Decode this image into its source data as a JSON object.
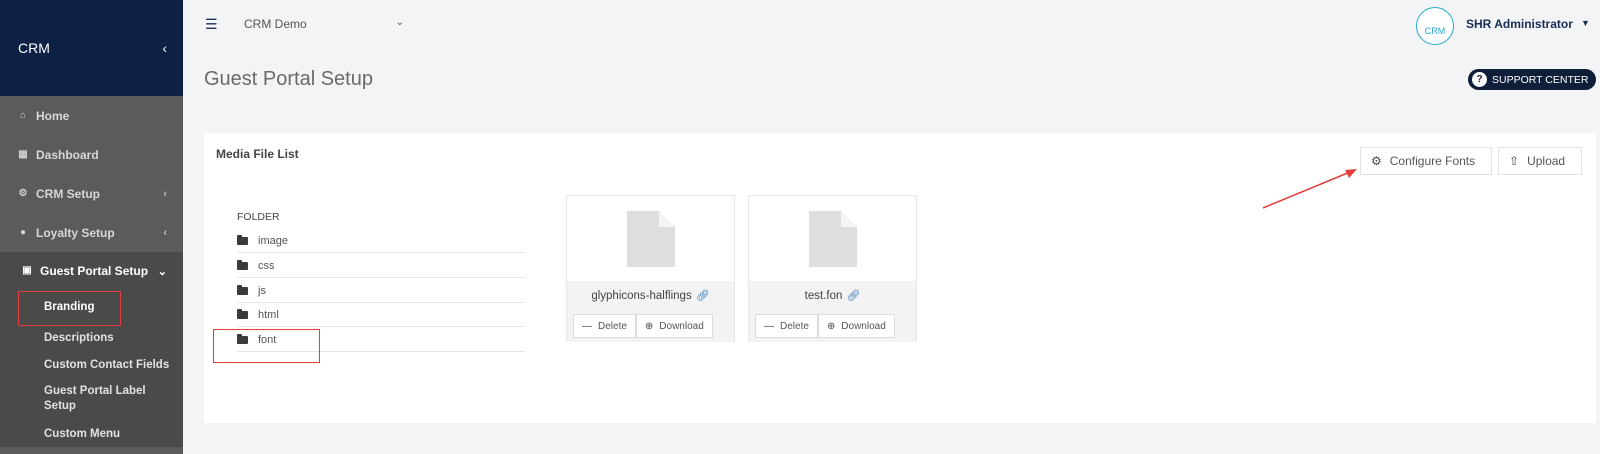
{
  "sidebar": {
    "brand": "CRM",
    "collapse_icon": "chevron-left-icon",
    "items": [
      {
        "label": "Home",
        "icon": "home-icon"
      },
      {
        "label": "Dashboard",
        "icon": "dashboard-icon"
      },
      {
        "label": "CRM Setup",
        "icon": "gear-icon"
      },
      {
        "label": "Loyalty Setup",
        "icon": "user-icon"
      },
      {
        "label": "Guest Portal Setup",
        "icon": "briefcase-icon"
      }
    ],
    "subitems": [
      {
        "label": "Branding"
      },
      {
        "label": "Descriptions"
      },
      {
        "label": "Custom Contact Fields"
      },
      {
        "label": "Guest Portal Label Setup"
      },
      {
        "label": "Custom Menu"
      }
    ]
  },
  "topbar": {
    "menu_icon": "hamburger-icon",
    "selected_app": "CRM Demo",
    "avatar_text": "CRM",
    "user_name": "SHR Administrator"
  },
  "page": {
    "title": "Guest Portal Setup",
    "support_label": "SUPPORT CENTER"
  },
  "panel": {
    "title": "Media File List",
    "configure_label": "Configure Fonts",
    "upload_label": "Upload",
    "folder_header": "FOLDER",
    "folders": [
      "image",
      "css",
      "js",
      "html",
      "font"
    ],
    "files": [
      {
        "name": "glyphicons-halflings",
        "delete_label": "Delete",
        "download_label": "Download"
      },
      {
        "name": "test.fon",
        "delete_label": "Delete",
        "download_label": "Download"
      }
    ]
  },
  "colors": {
    "sidebar_bg": "#5b5b5b",
    "brand_bg": "#0d2145",
    "annotation": "#e23d3d",
    "accent": "#25a9c9"
  }
}
